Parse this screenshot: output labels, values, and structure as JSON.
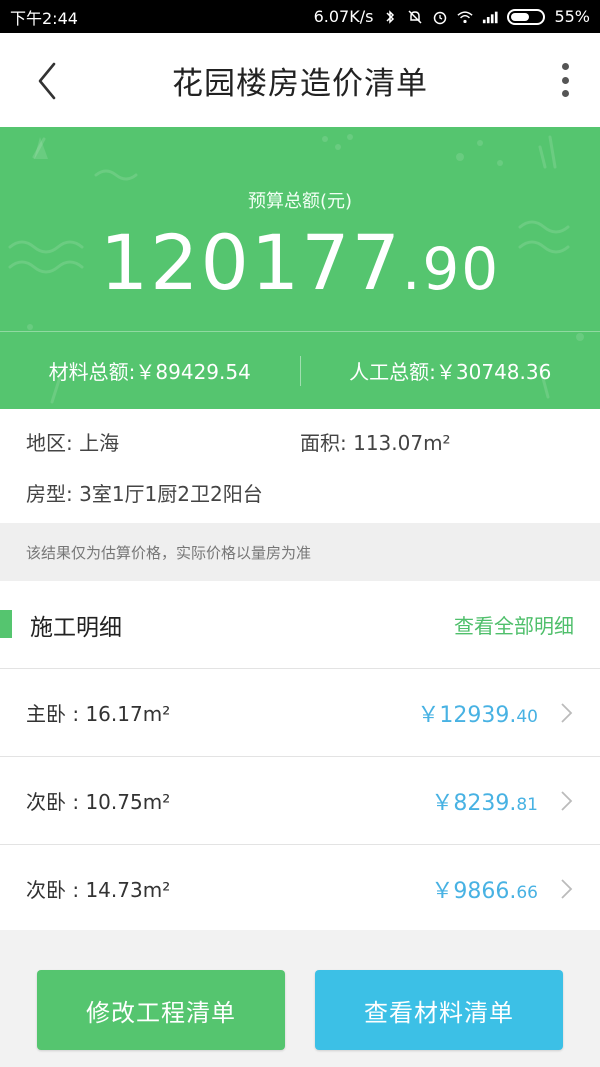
{
  "status_bar": {
    "time": "下午2:44",
    "network_speed": "6.07K/s",
    "battery": "55%"
  },
  "nav": {
    "title": "花园楼房造价清单"
  },
  "budget": {
    "label": "预算总额(元)",
    "total_integer": "120177",
    "total_decimal": ".90",
    "material_total": "材料总额:￥89429.54",
    "labor_total": "人工总额:￥30748.36",
    "background_color": "#55c56f"
  },
  "info": {
    "region": "地区: 上海",
    "area": "面积: 113.07m²",
    "layout": "房型: 3室1厅1厨2卫2阳台"
  },
  "notice": "该结果仅为估算价格，实际价格以量房为准",
  "section": {
    "title": "施工明细",
    "view_all": "查看全部明细"
  },
  "rooms": [
    {
      "name": "主卧 : 16.17m²",
      "price_main": "￥12939.",
      "price_cent": "40"
    },
    {
      "name": "次卧 : 10.75m²",
      "price_main": "￥8239.",
      "price_cent": "81"
    },
    {
      "name": "次卧 : 14.73m²",
      "price_main": "￥9866.",
      "price_cent": "66"
    }
  ],
  "buttons": {
    "edit_project": "修改工程清单",
    "view_materials": "查看材料清单"
  },
  "colors": {
    "accent_green": "#55c56f",
    "price_blue": "#48b2e3",
    "button_blue": "#3cc0e6"
  }
}
